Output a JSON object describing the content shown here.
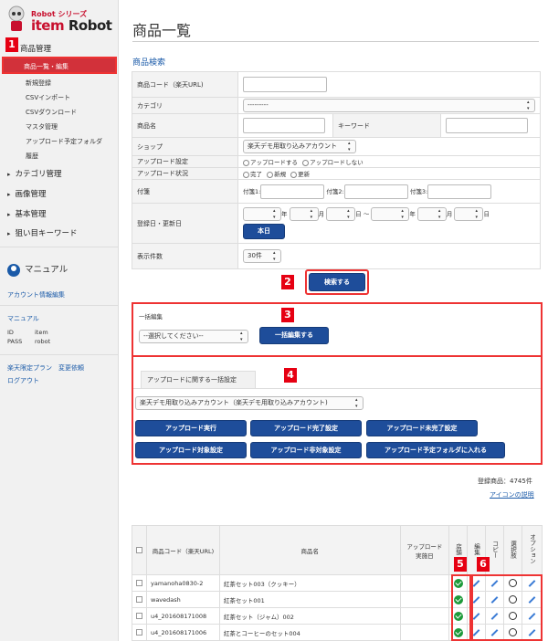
{
  "logo": {
    "series": "Robot シリーズ",
    "name_a": "item",
    "name_b": "Robot"
  },
  "sidebar": {
    "sections": [
      {
        "label": "商品管理"
      },
      {
        "label": "カテゴリ管理"
      },
      {
        "label": "画像管理"
      },
      {
        "label": "基本管理"
      },
      {
        "label": "狙い目キーワード"
      }
    ],
    "active_item": "商品一覧・編集",
    "sub_items": [
      "新規登録",
      "CSVインポート",
      "CSVダウンロード",
      "マスタ管理",
      "アップロード予定フォルダ",
      "履歴"
    ],
    "manual_title": "マニュアル",
    "account_link": "アカウント情報編集",
    "manual_link": "マニュアル",
    "id_label": "ID",
    "id_value": "item",
    "pass_label": "PASS",
    "pass_value": "robot",
    "plan_link": "楽天限定プラン　変更依頼",
    "logout_link": "ログアウト"
  },
  "markers": [
    "1",
    "2",
    "3",
    "4",
    "5",
    "6"
  ],
  "main": {
    "page_title": "商品一覧",
    "search_title": "商品検索",
    "search": {
      "code_label": "商品コード（楽天URL)",
      "category_label": "カテゴリ",
      "category_value": "---------",
      "name_label": "商品名",
      "keyword_label": "キーワード",
      "shop_label": "ショップ",
      "shop_value": "楽天デモ用取り込みアカウント",
      "upload_setting_label": "アップロード設定",
      "upload_setting_opts": [
        "アップロードする",
        "アップロードしない"
      ],
      "upload_status_label": "アップロード状況",
      "upload_status_opts": [
        "完了",
        "新規",
        "更新"
      ],
      "tag_label": "付箋",
      "tag1": "付箋1:",
      "tag2": "付箋2:",
      "tag3": "付箋3:",
      "date_label": "登録日・更新日",
      "date_parts": [
        "年",
        "月",
        "日 〜",
        "年",
        "月",
        "日"
      ],
      "today_btn": "本日",
      "count_label": "表示件数",
      "count_value": "30件",
      "search_btn": "検索する"
    },
    "bulk": {
      "title": "一括編集",
      "select_value": "--選択してください--",
      "apply_btn": "一括編集する",
      "upload_tab": "アップロードに関する一括設定",
      "account_value": "楽天デモ用取り込みアカウント（楽天デモ用取り込みアカウント)",
      "buttons": [
        "アップロード実行",
        "アップロード完了設定",
        "アップロード未完了設定",
        "アップロード対象設定",
        "アップロード非対象設定",
        "アップロード予定フォルダに入れる"
      ]
    },
    "registered": "登録商品：4745件",
    "icon_help": "アイコンの説明",
    "table": {
      "headers": [
        "商品コード（楽天URL)",
        "商品名",
        "アップロード実施日",
        "店舗",
        "編集",
        "コピー",
        "選択肢",
        "オプション"
      ],
      "rows": [
        {
          "code": "yamanoha0830-2",
          "name": "紅茶セット003（クッキー）"
        },
        {
          "code": "wavedash",
          "name": "紅茶セット001"
        },
        {
          "code": "u4_201608171008",
          "name": "紅茶セット（ジャム）002"
        },
        {
          "code": "u4_201608171006",
          "name": "紅茶とコーヒーのセット004"
        }
      ]
    }
  }
}
